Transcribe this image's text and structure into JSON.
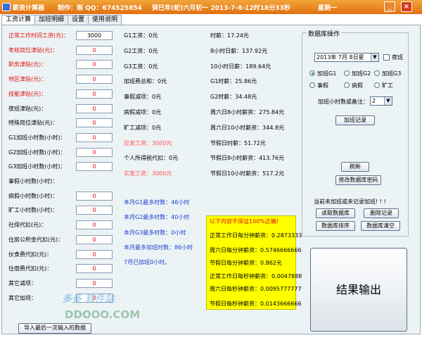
{
  "title": {
    "app": "薪资计算器",
    "author": "制作：雨  QQ：674525854",
    "date": "癸巳年(蛇)六月初一  2013-7-8-12时18分33秒",
    "weekday": "星期一"
  },
  "tabs": [
    "工资计算",
    "加班明细",
    "设置",
    "使用说明"
  ],
  "left_fields": [
    {
      "label": "正常工作时间工资(元)：",
      "value": "3000"
    },
    {
      "label": "考核岗位津贴(元)：",
      "value": "0"
    },
    {
      "label": "职务津贴(元)：",
      "value": "0"
    },
    {
      "label": "地区津贴(元)：",
      "value": "0"
    },
    {
      "label": "技能津贴(元)：",
      "value": "0"
    },
    {
      "label": "夜班津贴(元)：",
      "value": "0"
    },
    {
      "label": "特殊岗位津贴(元)：",
      "value": "0"
    },
    {
      "label": "G1加班小时数(小时)：",
      "value": "0"
    },
    {
      "label": "G2加班小时数(小时)：",
      "value": "0"
    },
    {
      "label": "G3加班小时数(小时)：",
      "value": "0"
    },
    {
      "label": "事假小时数(小时)：",
      "value": ""
    },
    {
      "label": "病假小时数(小时)：",
      "value": "0"
    },
    {
      "label": "旷工小时数(小时)：",
      "value": "0"
    },
    {
      "label": "社保代扣(元)：",
      "value": "0"
    },
    {
      "label": "住房公积金代扣(元)：",
      "value": "0"
    },
    {
      "label": "伙食费代扣(元)：",
      "value": "0"
    },
    {
      "label": "住宿费代扣(元)：",
      "value": "0"
    },
    {
      "label": "其它减项：",
      "value": "0"
    },
    {
      "label": "其它加项：",
      "value": "0"
    }
  ],
  "mid_fields": [
    "G1工资：0元",
    "G2工资：0元",
    "G3工资：0元",
    "加班费总和：0元",
    "事假减项：0元",
    "病假减项：0元",
    "旷工减项：0元",
    "应发工资：3000元",
    "个人所得税代扣：0元",
    "实发工资：3000元"
  ],
  "month_stats": [
    "本月G1最多时数：46小时",
    "本月G2最多时数：40小时",
    "本月G3最多时数：0小时",
    "本月最多加班时数：86小时",
    "7月已加班0小时。"
  ],
  "rates": [
    "时薪：17.24元",
    "8小时日薪：137.92元",
    "10小时日薪：189.64元",
    "G1时薪：25.86元",
    "G2时薪：34.48元",
    "周六日8小时薪资：275.84元",
    "周六日10小时薪资：344.8元",
    "节假日时薪：51.72元",
    "节假日8小时薪资：413.76元",
    "节假日10小时薪资：517.2元"
  ],
  "warning": {
    "header": "以下内容不保证100%正确!",
    "lines": [
      "正常工作日每分钟薪资：0.2873333",
      "周六日每分钟薪资：0.5746666666",
      "节假日每分钟薪资：0.862元",
      "正常工作日每秒钟薪资：0.0047888",
      "周六日每秒钟薪资：0.0095777777",
      "节假日每秒钟薪资：0.0143666666"
    ]
  },
  "db": {
    "group_title": "数据库操作",
    "date_value": "2013年 7月 8日星",
    "night_label": "夜班",
    "radios": [
      "加班G1",
      "加班G2",
      "加班G3",
      "事假",
      "病假",
      "旷工"
    ],
    "selected_radio": 0,
    "hours_label": "加班小时数或备注：",
    "hours_value": "2",
    "record_btn": "加班记录",
    "refresh_btn": "刷新",
    "pwd_btn": "修改数据库密码",
    "notice": "当前未加班或未记录加班! ! !",
    "read_btn": "读取数据库",
    "delete_btn": "删除记录",
    "sort_btn": "数据库排序",
    "clear_btn": "数据库清空"
  },
  "result_btn": "结果输出",
  "import_btn": "导入最后一次输入的数据",
  "watermark": {
    "top": "多多 软件站",
    "bottom": "DDOOO.COM"
  }
}
